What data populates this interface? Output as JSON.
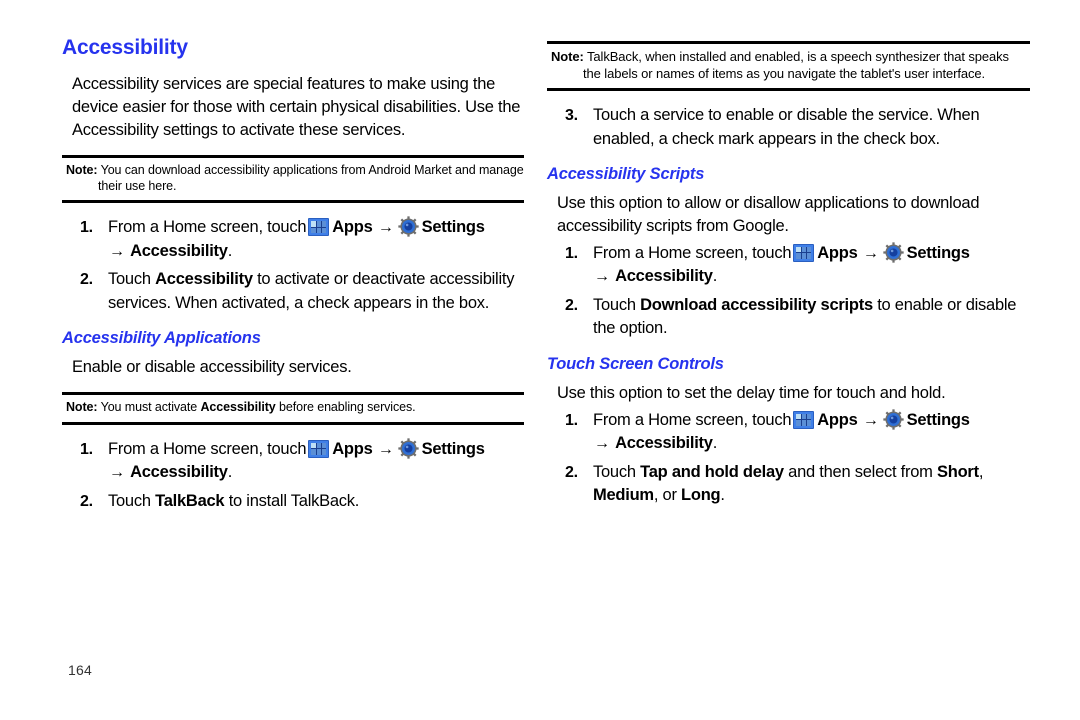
{
  "document": {
    "page_number": "164",
    "accent_color": "#2633ee"
  },
  "left_column": {
    "title": "Accessibility",
    "intro": "Accessibility services are special features to make using the device easier for those with certain physical disabilities. Use the Accessibility settings to activate these services.",
    "note_1": {
      "label": "Note:",
      "text": "You can download accessibility applications from Android Market and manage their use here."
    },
    "steps_1": [
      {
        "num": "1.",
        "prefix": "From a Home screen, touch",
        "apps_icon": "apps-grid-icon",
        "apps_label": "Apps",
        "arrow": "→",
        "settings_icon": "gear-icon",
        "settings_label": "Settings",
        "arrow_2": "→",
        "destination": "Accessibility",
        "period": "."
      },
      {
        "num": "2.",
        "lead": "Touch ",
        "bold": "Accessibility",
        "tail": " to activate or deactivate accessibility services. When activated, a check appears in the box."
      }
    ],
    "section_applications": {
      "title": "Accessibility Applications",
      "body": "Enable or disable accessibility services.",
      "note": {
        "label": "Note:",
        "pre": "You must activate ",
        "bold": "Accessibility",
        "post": " before enabling services."
      },
      "steps": [
        {
          "num": "1.",
          "prefix": "From a Home screen, touch",
          "apps_label": "Apps",
          "arrow": "→",
          "settings_label": "Settings",
          "arrow_2": "→",
          "destination": "Accessibility",
          "period": "."
        },
        {
          "num": "2.",
          "lead": "Touch ",
          "bold": "TalkBack",
          "tail": " to install TalkBack."
        }
      ]
    }
  },
  "right_column": {
    "note_talkback": {
      "label": "Note:",
      "text": "TalkBack, when installed and enabled, is a speech synthesizer that speaks the labels or names of items as you navigate the tablet's user interface."
    },
    "step_3": {
      "num": "3.",
      "text": "Touch a service to enable or disable the service. When enabled, a check mark appears in the check box."
    },
    "section_scripts": {
      "title": "Accessibility Scripts",
      "body": "Use this option to allow or disallow applications to download accessibility scripts from Google.",
      "steps": [
        {
          "num": "1.",
          "prefix": "From a Home screen, touch",
          "apps_label": "Apps",
          "arrow": "→",
          "settings_label": "Settings",
          "arrow_2": "→",
          "destination": "Accessibility",
          "period": "."
        },
        {
          "num": "2.",
          "lead": "Touch ",
          "bold": "Download accessibility scripts",
          "tail": " to enable or disable the option."
        }
      ]
    },
    "section_touch": {
      "title": "Touch Screen Controls",
      "body": "Use this option to set the delay time for touch and hold.",
      "steps": [
        {
          "num": "1.",
          "prefix": "From a Home screen, touch",
          "apps_label": "Apps",
          "arrow": "→",
          "settings_label": "Settings",
          "arrow_2": "→",
          "destination": "Accessibility",
          "period": "."
        },
        {
          "num": "2.",
          "lead": "Touch ",
          "bold": "Tap and hold delay",
          "mid": " and then select from ",
          "bold2": "Short",
          "mid2": ", ",
          "bold3": "Medium",
          "mid3": ", or ",
          "bold4": "Long",
          "tail": "."
        }
      ]
    }
  }
}
